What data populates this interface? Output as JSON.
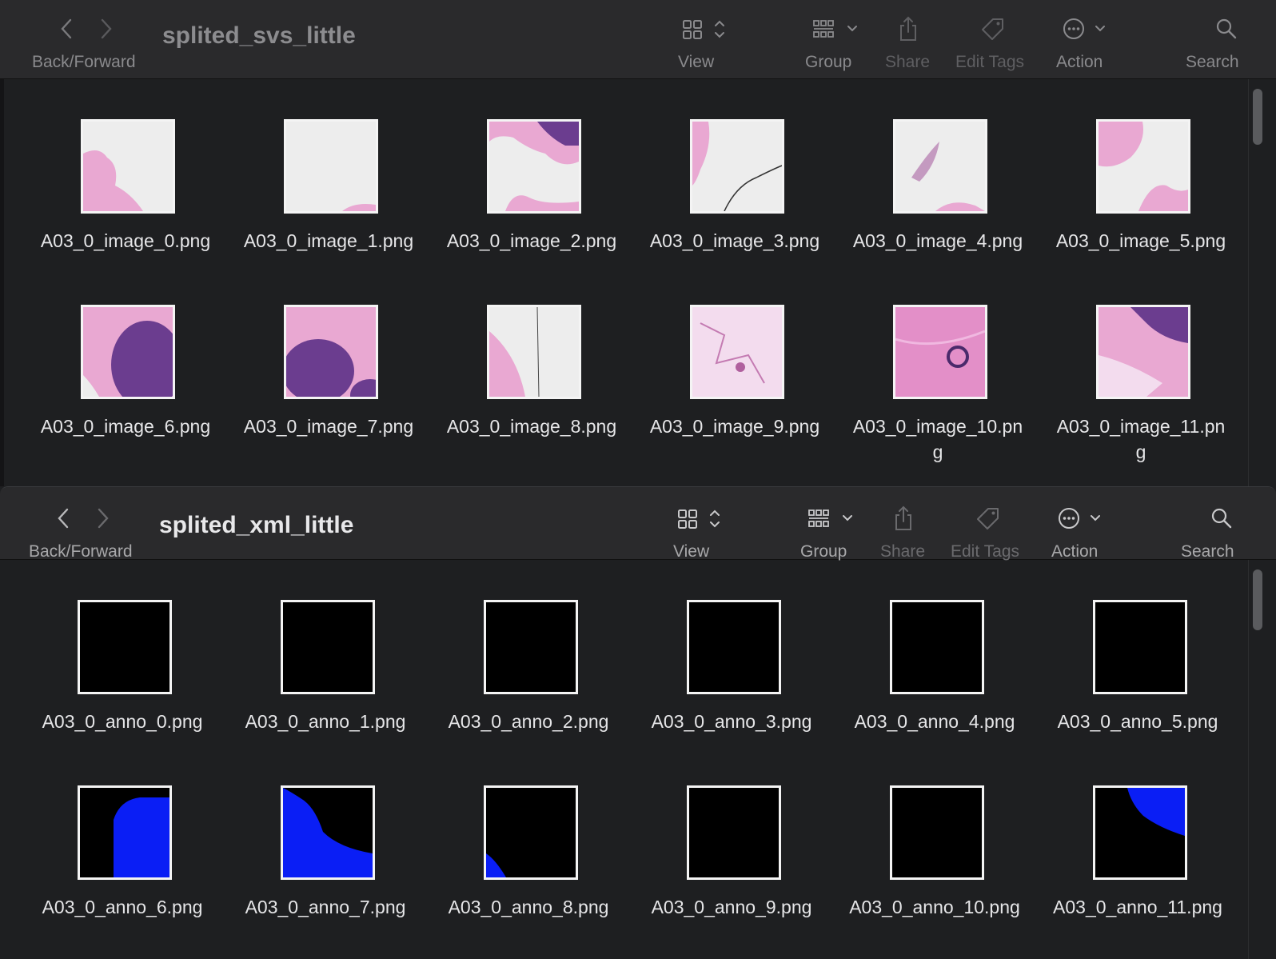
{
  "windows": [
    {
      "id": "top",
      "title": "splited_svs_little",
      "toolbar": {
        "back_forward": "Back/Forward",
        "view": "View",
        "group": "Group",
        "share": "Share",
        "edit_tags": "Edit Tags",
        "action": "Action",
        "search": "Search"
      },
      "files": [
        {
          "name": "A03_0_image_0.png",
          "thumb": "tissue-0"
        },
        {
          "name": "A03_0_image_1.png",
          "thumb": "tissue-1"
        },
        {
          "name": "A03_0_image_2.png",
          "thumb": "tissue-2"
        },
        {
          "name": "A03_0_image_3.png",
          "thumb": "tissue-3"
        },
        {
          "name": "A03_0_image_4.png",
          "thumb": "tissue-4"
        },
        {
          "name": "A03_0_image_5.png",
          "thumb": "tissue-5"
        },
        {
          "name": "A03_0_image_6.png",
          "thumb": "tissue-6"
        },
        {
          "name": "A03_0_image_7.png",
          "thumb": "tissue-7"
        },
        {
          "name": "A03_0_image_8.png",
          "thumb": "tissue-8"
        },
        {
          "name": "A03_0_image_9.png",
          "thumb": "tissue-9"
        },
        {
          "name": "A03_0_image_10.png",
          "thumb": "tissue-10"
        },
        {
          "name": "A03_0_image_11.png",
          "thumb": "tissue-11"
        }
      ]
    },
    {
      "id": "bottom",
      "title": "splited_xml_little",
      "toolbar": {
        "back_forward": "Back/Forward",
        "view": "View",
        "group": "Group",
        "share": "Share",
        "edit_tags": "Edit Tags",
        "action": "Action",
        "search": "Search"
      },
      "files": [
        {
          "name": "A03_0_anno_0.png",
          "thumb": "mask-empty"
        },
        {
          "name": "A03_0_anno_1.png",
          "thumb": "mask-empty"
        },
        {
          "name": "A03_0_anno_2.png",
          "thumb": "mask-empty"
        },
        {
          "name": "A03_0_anno_3.png",
          "thumb": "mask-empty"
        },
        {
          "name": "A03_0_anno_4.png",
          "thumb": "mask-empty"
        },
        {
          "name": "A03_0_anno_5.png",
          "thumb": "mask-empty"
        },
        {
          "name": "A03_0_anno_6.png",
          "thumb": "mask-6"
        },
        {
          "name": "A03_0_anno_7.png",
          "thumb": "mask-7"
        },
        {
          "name": "A03_0_anno_8.png",
          "thumb": "mask-8"
        },
        {
          "name": "A03_0_anno_9.png",
          "thumb": "mask-empty"
        },
        {
          "name": "A03_0_anno_10.png",
          "thumb": "mask-empty"
        },
        {
          "name": "A03_0_anno_11.png",
          "thumb": "mask-11"
        }
      ]
    }
  ],
  "colors": {
    "mask_blue": "#0a1ef5",
    "tissue_pink": "#e9a8d2",
    "tissue_purple": "#6b3d8f",
    "slide_bg": "#ededed"
  }
}
